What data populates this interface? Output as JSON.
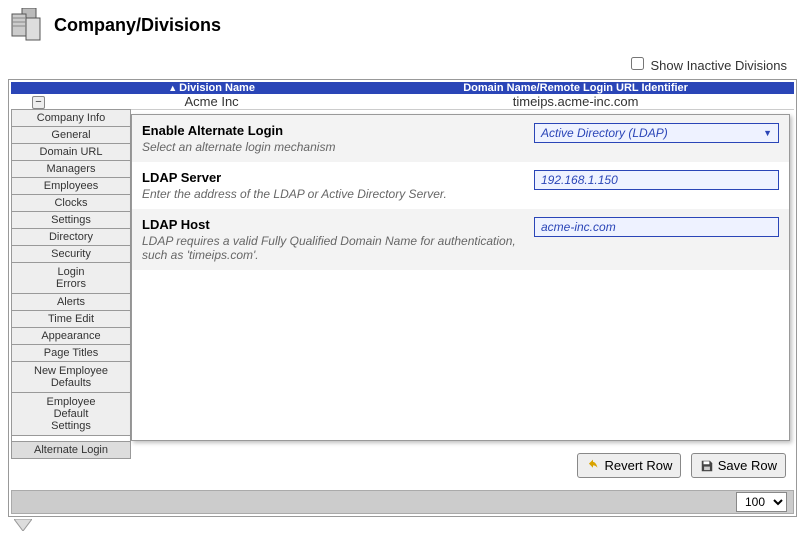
{
  "header": {
    "title": "Company/Divisions"
  },
  "toolbar": {
    "show_inactive_label": "Show Inactive Divisions"
  },
  "table": {
    "columns": {
      "name": "Division Name",
      "url": "Domain Name/Remote Login URL Identifier"
    },
    "row": {
      "name": "Acme Inc",
      "url": "timeips.acme-inc.com"
    }
  },
  "sidebar": {
    "items": [
      "Company Info",
      "General",
      "Domain URL",
      "Managers",
      "Employees",
      "Clocks",
      "Settings",
      "Directory",
      "Security",
      "Login\nErrors",
      "Alerts",
      "Time Edit",
      "Appearance",
      "Page Titles",
      "New Employee\nDefaults",
      "Employee\nDefault\nSettings",
      "Alternate Login"
    ]
  },
  "form": {
    "alt_login": {
      "title": "Enable Alternate Login",
      "desc": "Select an alternate login mechanism",
      "value": "Active Directory (LDAP)"
    },
    "ldap_server": {
      "title": "LDAP Server",
      "desc": "Enter the address of the LDAP or Active Directory Server.",
      "value": "192.168.1.150"
    },
    "ldap_host": {
      "title": "LDAP Host",
      "desc": "LDAP requires a valid Fully Qualified Domain Name for authentication, such as 'timeips.com'.",
      "value": "acme-inc.com"
    }
  },
  "buttons": {
    "revert": "Revert Row",
    "save": "Save Row"
  },
  "footer": {
    "page_size": "100"
  }
}
